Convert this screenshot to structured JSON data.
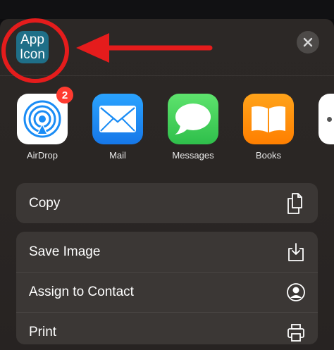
{
  "header": {
    "app_icon_line1": "App",
    "app_icon_line2": "Icon"
  },
  "share_apps": [
    {
      "label": "AirDrop",
      "badge": "2",
      "icon": "airdrop-icon",
      "color": "#ffffff"
    },
    {
      "label": "Mail",
      "icon": "mail-icon",
      "color": "#1a8cf5"
    },
    {
      "label": "Messages",
      "icon": "messages-icon",
      "color": "#34c759"
    },
    {
      "label": "Books",
      "icon": "books-icon",
      "color": "#ff9500"
    }
  ],
  "actions": {
    "copy": {
      "label": "Copy",
      "icon": "copy-icon"
    },
    "save_image": {
      "label": "Save Image",
      "icon": "save-icon"
    },
    "assign_to_contact": {
      "label": "Assign to Contact",
      "icon": "contact-icon"
    },
    "print": {
      "label": "Print",
      "icon": "print-icon"
    }
  },
  "annotation": {
    "color": "#e51c1c"
  }
}
